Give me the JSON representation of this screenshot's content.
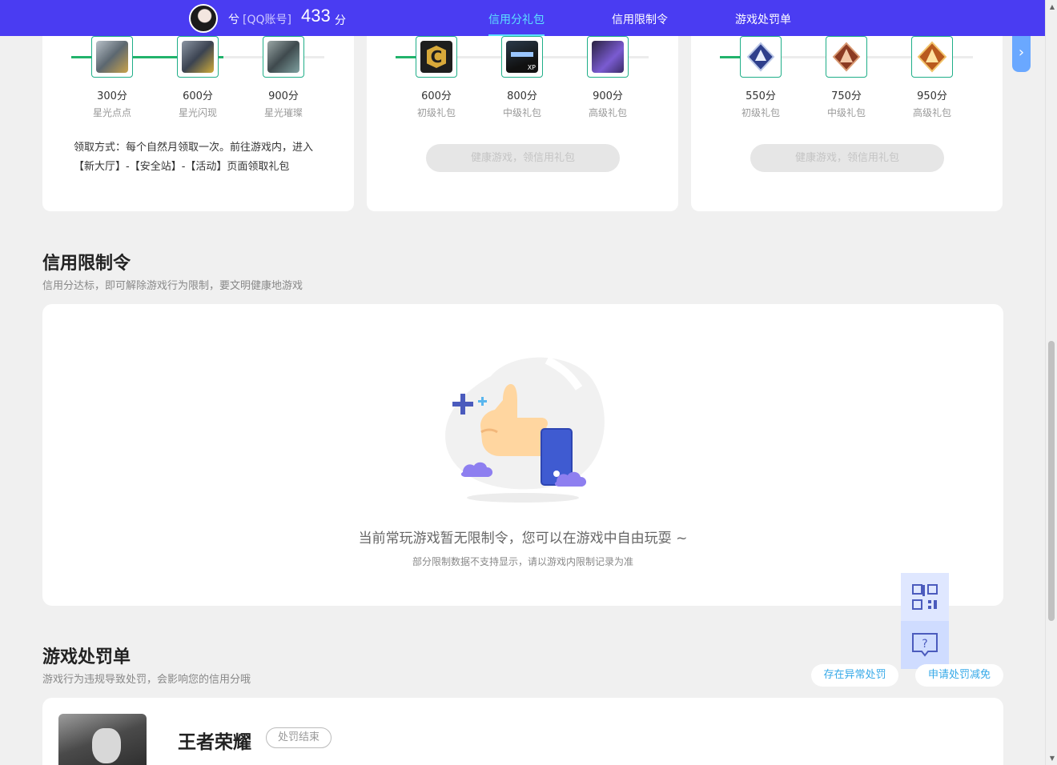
{
  "nav": {
    "user_name": "兮",
    "account_type": "[QQ账号]",
    "score": "433",
    "score_unit": "分",
    "tabs": [
      "信用分礼包",
      "信用限制令",
      "游戏处罚单"
    ],
    "active_tab": 0,
    "accent": "#4a3cf2",
    "active_color": "#5ce1ff"
  },
  "gift_cards": [
    {
      "progress": 0.6,
      "items": [
        {
          "score": "300分",
          "name": "星光点点",
          "icon": "starlight-dots-icon"
        },
        {
          "score": "600分",
          "name": "星光闪现",
          "icon": "starlight-flash-icon"
        },
        {
          "score": "900分",
          "name": "星光璀璨",
          "icon": "starlight-brilliant-icon"
        }
      ],
      "howto": "领取方式：每个自然月领取一次。前往游戏内，进入【新大厅】-【安全站】-【活动】页面领取礼包"
    },
    {
      "progress": 0.12,
      "items": [
        {
          "score": "600分",
          "name": "初级礼包",
          "icon": "c-badge-icon"
        },
        {
          "score": "800分",
          "name": "中级礼包",
          "icon": "xp-card-icon"
        },
        {
          "score": "900分",
          "name": "高级礼包",
          "icon": "loot-box-icon"
        }
      ],
      "button": "健康游戏，领信用礼包"
    },
    {
      "progress": 0.12,
      "items": [
        {
          "score": "550分",
          "name": "初级礼包",
          "icon": "blue-rank-icon"
        },
        {
          "score": "750分",
          "name": "中级礼包",
          "icon": "bronze-rank-icon"
        },
        {
          "score": "950分",
          "name": "高级礼包",
          "icon": "gold-rank-icon"
        }
      ],
      "button": "健康游戏，领信用礼包"
    }
  ],
  "restriction": {
    "title": "信用限制令",
    "subtitle": "信用分达标，即可解除游戏行为限制，要文明健康地游戏",
    "empty_main": "当前常玩游戏暂无限制令，您可以在游戏中自由玩耍 ~",
    "empty_sub": "部分限制数据不支持显示，请以游戏内限制记录为准"
  },
  "penalty": {
    "title": "游戏处罚单",
    "subtitle": "游戏行为违规导致处罚，会影响您的信用分哦",
    "link_abnormal": "存在异常处罚",
    "link_reduce": "申请处罚减免",
    "game_name": "王者荣耀",
    "status": "处罚结束"
  },
  "float": {
    "qr_label": "?"
  }
}
